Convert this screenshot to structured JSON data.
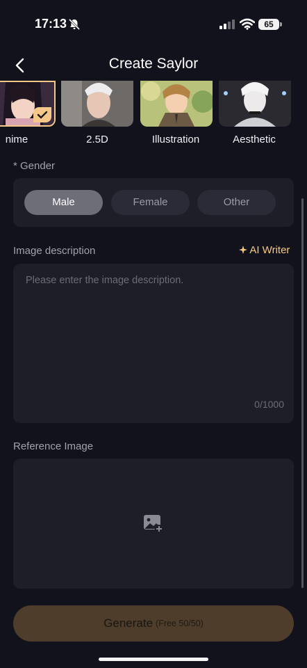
{
  "status_bar": {
    "time": "17:13",
    "battery": "65"
  },
  "header": {
    "title": "Create Saylor"
  },
  "styles": [
    {
      "label": "nime",
      "selected": true
    },
    {
      "label": "2.5D"
    },
    {
      "label": "Illustration"
    },
    {
      "label": "Aesthetic"
    }
  ],
  "gender": {
    "label": "* Gender",
    "options": [
      "Male",
      "Female",
      "Other"
    ],
    "selected": "Male"
  },
  "description": {
    "label": "Image description",
    "ai_writer": "AI Writer",
    "placeholder": "Please enter the image description.",
    "value": "",
    "counter": "0/1000"
  },
  "reference": {
    "label": "Reference Image"
  },
  "generate": {
    "label": "Generate",
    "sub": "(Free 50/50)"
  },
  "colors": {
    "accent": "#f6c983",
    "background": "#12121c",
    "panel": "#1e1e29",
    "button": "#4d3d2a"
  }
}
